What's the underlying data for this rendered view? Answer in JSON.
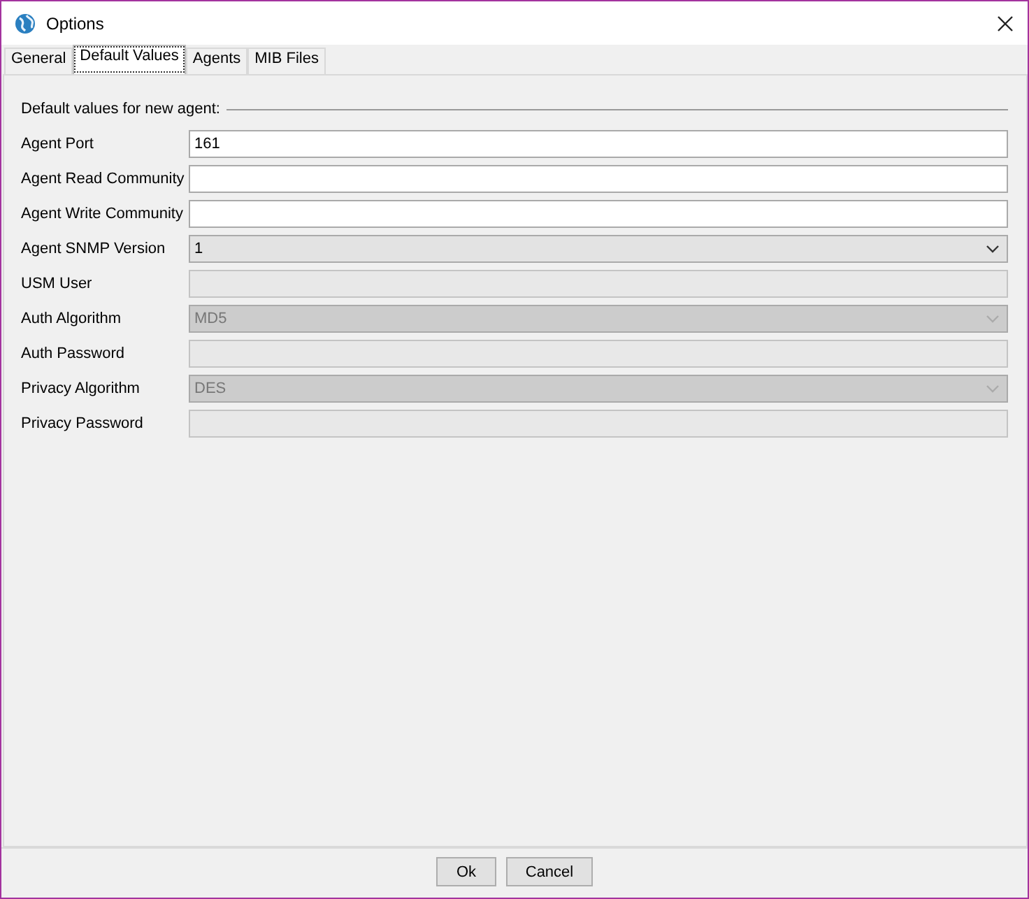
{
  "window": {
    "title": "Options"
  },
  "tabs": [
    {
      "label": "General",
      "selected": false
    },
    {
      "label": "Default Values",
      "selected": true
    },
    {
      "label": "Agents",
      "selected": false
    },
    {
      "label": "MIB Files",
      "selected": false
    }
  ],
  "section": {
    "title": "Default values for new agent:"
  },
  "fields": [
    {
      "label": "Agent Port",
      "kind": "text",
      "value": "161",
      "disabled": false
    },
    {
      "label": "Agent Read Community",
      "kind": "text",
      "disabled": false
    },
    {
      "label": "Agent Write Community",
      "kind": "text",
      "disabled": false
    },
    {
      "label": "Agent SNMP Version",
      "kind": "dropdown",
      "value": "1",
      "disabled": false
    },
    {
      "label": "USM User",
      "kind": "text",
      "disabled": true
    },
    {
      "label": "Auth Algorithm",
      "kind": "dropdown",
      "value": "MD5",
      "disabled": true
    },
    {
      "label": "Auth Password",
      "kind": "text",
      "disabled": true
    },
    {
      "label": "Privacy Algorithm",
      "kind": "dropdown",
      "value": "DES",
      "disabled": true
    },
    {
      "label": "Privacy Password",
      "kind": "text",
      "disabled": true
    }
  ],
  "buttons": [
    "Ok",
    "Cancel"
  ]
}
